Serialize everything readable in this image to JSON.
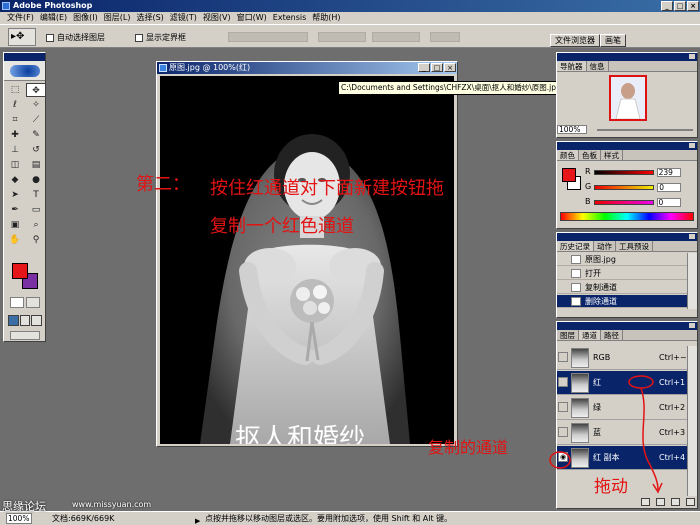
{
  "app": {
    "title": "Adobe Photoshop"
  },
  "window_buttons": [
    "_",
    "□",
    "×"
  ],
  "menu": [
    "文件(F)",
    "编辑(E)",
    "图像(I)",
    "图层(L)",
    "选择(S)",
    "滤镜(T)",
    "视图(V)",
    "窗口(W)",
    "Extensis",
    "帮助(H)"
  ],
  "options": {
    "auto_select_layer": "自动选择图层",
    "show_bounding_box": "显示定界框",
    "file_browser_tab": "文件浏览器",
    "brushes_tab": "画笔"
  },
  "document": {
    "title": "原图.jpg @ 100%(红)",
    "path_tooltip": "C:\\Documents and Settings\\CHFZX\\桌面\\抠人和婚纱\\原图.jpg @ 100%(红)",
    "watermark_text": "抠人和婚纱"
  },
  "annotations": {
    "step_label": "第二：",
    "instruction_line1": "按住红通道对下面新建按钮拖",
    "instruction_line2": "复制一个红色通道",
    "copied_channel": "复制的通道",
    "drag": "拖动"
  },
  "navigator": {
    "tabs": [
      "导航器",
      "信息"
    ],
    "zoom": "100%"
  },
  "color_panel": {
    "tabs": [
      "颜色",
      "色板",
      "样式"
    ],
    "fg_color": "#e6151a",
    "rows": [
      {
        "label": "R",
        "value": "239"
      },
      {
        "label": "G",
        "value": "0"
      },
      {
        "label": "B",
        "value": "0"
      }
    ]
  },
  "history": {
    "tabs": [
      "历史记录",
      "动作",
      "工具预设"
    ],
    "items": [
      {
        "label": "原图.jpg",
        "selected": false
      },
      {
        "label": "打开",
        "selected": false
      },
      {
        "label": "复制通道",
        "selected": false
      },
      {
        "label": "删除通道",
        "selected": true
      }
    ]
  },
  "channels": {
    "tabs": [
      "图层",
      "通道",
      "路径"
    ],
    "items": [
      {
        "name": "RGB",
        "shortcut": "Ctrl+~",
        "visible": false,
        "selected": false
      },
      {
        "name": "红",
        "shortcut": "Ctrl+1",
        "visible": false,
        "selected": true
      },
      {
        "name": "绿",
        "shortcut": "Ctrl+2",
        "visible": false,
        "selected": false
      },
      {
        "name": "蓝",
        "shortcut": "Ctrl+3",
        "visible": false,
        "selected": false
      },
      {
        "name": "红 副本",
        "shortcut": "Ctrl+4",
        "visible": true,
        "selected": true
      }
    ]
  },
  "status": {
    "zoom": "100%",
    "doc_size": "文档:669K/669K",
    "message": "点按并拖移以移动图层或选区。要用附加选项，使用 Shift 和 Alt 键。"
  },
  "site_watermark": {
    "name": "思缘论坛",
    "url": "www.missyuan.com"
  }
}
